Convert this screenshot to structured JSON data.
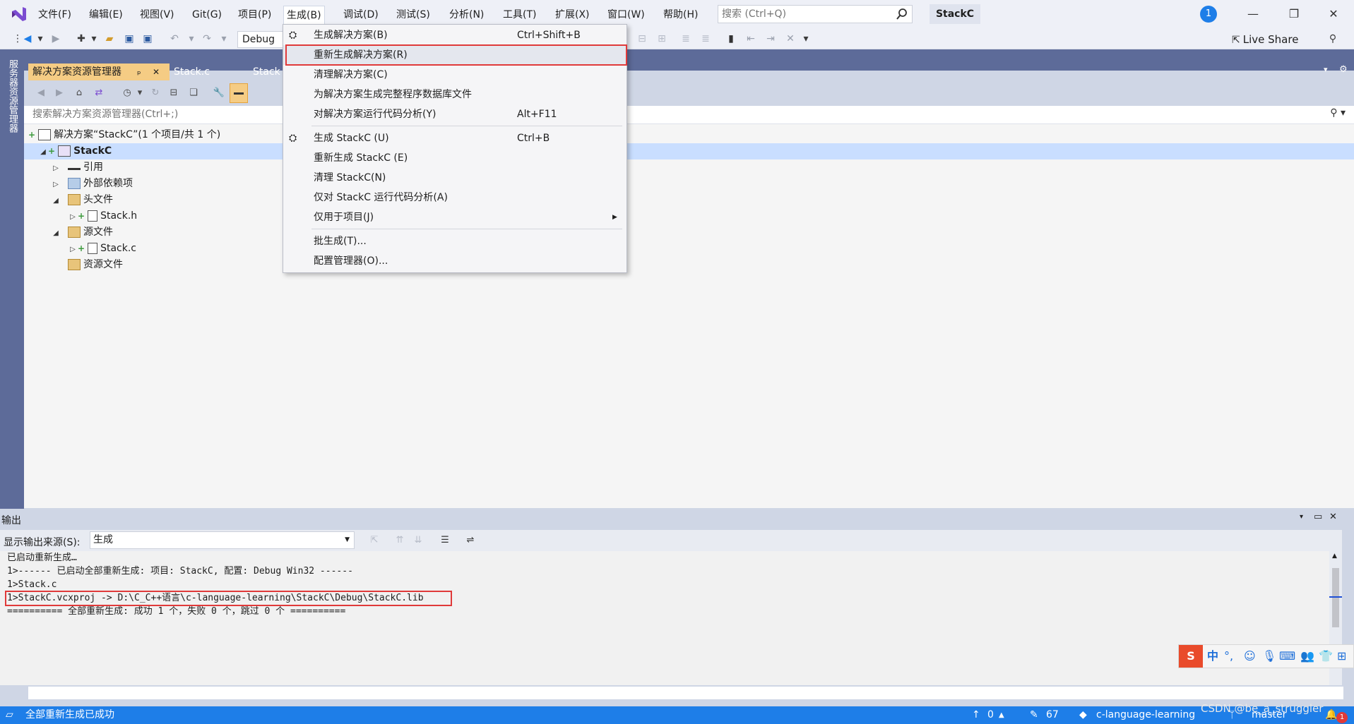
{
  "titlebar": {
    "menus": [
      "文件(F)",
      "编辑(E)",
      "视图(V)",
      "Git(G)",
      "项目(P)",
      "生成(B)",
      "调试(D)",
      "测试(S)",
      "分析(N)",
      "工具(T)",
      "扩展(X)",
      "窗口(W)",
      "帮助(H)"
    ],
    "search_placeholder": "搜索 (Ctrl+Q)",
    "app_name": "StackC",
    "notification_count": "1"
  },
  "toolbar": {
    "configuration": "Debug",
    "live_share": "Live Share"
  },
  "left_strip": {
    "server_explorer": "服务器资源管理器"
  },
  "tabs": {
    "solution_explorer": "解决方案资源管理器",
    "pin_glyph": "ₚ",
    "close_glyph": "✕",
    "stack_c": "Stack.c",
    "stack_partial": "Stack"
  },
  "solution_explorer": {
    "search_placeholder": "搜索解决方案资源管理器(Ctrl+;)",
    "tree": {
      "solution": "解决方案“StackC”(1 个项目/共 1 个)",
      "project": "StackC",
      "references": "引用",
      "external_deps": "外部依赖项",
      "header_files": "头文件",
      "stack_h": "Stack.h",
      "source_files": "源文件",
      "stack_c": "Stack.c",
      "resource_files": "资源文件"
    }
  },
  "build_menu": {
    "build_solution": "生成解决方案(B)",
    "build_solution_sc": "Ctrl+Shift+B",
    "rebuild_solution": "重新生成解决方案(R)",
    "clean_solution": "清理解决方案(C)",
    "full_pdb": "为解决方案生成完整程序数据库文件",
    "code_analysis_solution": "对解决方案运行代码分析(Y)",
    "code_analysis_solution_sc": "Alt+F11",
    "build_project": "生成 StackC (U)",
    "build_project_sc": "Ctrl+B",
    "rebuild_project": "重新生成 StackC (E)",
    "clean_project": "清理 StackC(N)",
    "code_analysis_project": "仅对 StackC 运行代码分析(A)",
    "project_only": "仅用于项目(J)",
    "batch_build": "批生成(T)...",
    "config_manager": "配置管理器(O)..."
  },
  "output": {
    "title": "输出",
    "source_label": "显示输出来源(S):",
    "source_value": "生成",
    "lines": [
      "已启动重新生成…",
      "1>------ 已启动全部重新生成: 项目: StackC, 配置: Debug Win32 ------",
      "1>Stack.c",
      "1>StackC.vcxproj -> D:\\C_C++语言\\c-language-learning\\StackC\\Debug\\StackC.lib",
      "========== 全部重新生成: 成功 1 个，失败 0 个，跳过 0 个 =========="
    ]
  },
  "statusbar": {
    "message": "全部重新生成已成功",
    "up_count": "0",
    "edit_count": "67",
    "repo": "c-language-learning",
    "branch": "master",
    "bell_count": "1"
  },
  "ime": {
    "label": "中"
  },
  "watermark": "CSDN @be_a_struggler",
  "colors": {
    "accent": "#1e7ee8",
    "tab_active": "#f5cc84",
    "frame": "#5d6b99",
    "highlight_box": "#e03a3a"
  }
}
